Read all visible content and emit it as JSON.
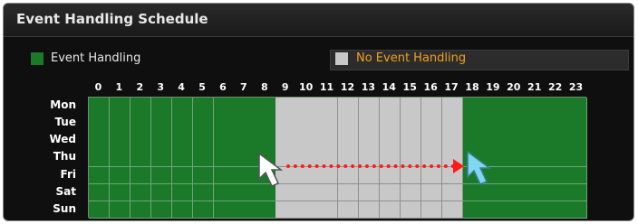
{
  "window": {
    "title": "Event Handling Schedule"
  },
  "legend": {
    "event_handling_label": "Event Handling",
    "no_event_handling_label": "No Event Handling",
    "event_color": "#1b7a2a",
    "no_event_color": "#c8c8c8",
    "no_event_text_color": "#f0a020"
  },
  "hours": [
    "0",
    "1",
    "2",
    "3",
    "4",
    "5",
    "6",
    "7",
    "8",
    "9",
    "10",
    "11",
    "12",
    "13",
    "14",
    "15",
    "16",
    "17",
    "18",
    "19",
    "20",
    "21",
    "22",
    "23"
  ],
  "days": [
    "Mon",
    "Tue",
    "Wed",
    "Thu",
    "Fri",
    "Sat",
    "Sun"
  ],
  "schedule": {
    "event_handling_hours": [
      0,
      1,
      2,
      3,
      4,
      5,
      6,
      7,
      8,
      18,
      19,
      20,
      21,
      22,
      23
    ],
    "no_event_handling_hours": [
      9,
      10,
      11,
      12,
      13,
      14,
      15,
      16,
      17
    ]
  },
  "drag_indicator": {
    "from_hour": 9,
    "to_hour": 18,
    "color": "#ff1a1a",
    "row_day": "Thu"
  },
  "cursors": {
    "start_color": "#ffffff",
    "end_color": "#7fd8f0"
  }
}
